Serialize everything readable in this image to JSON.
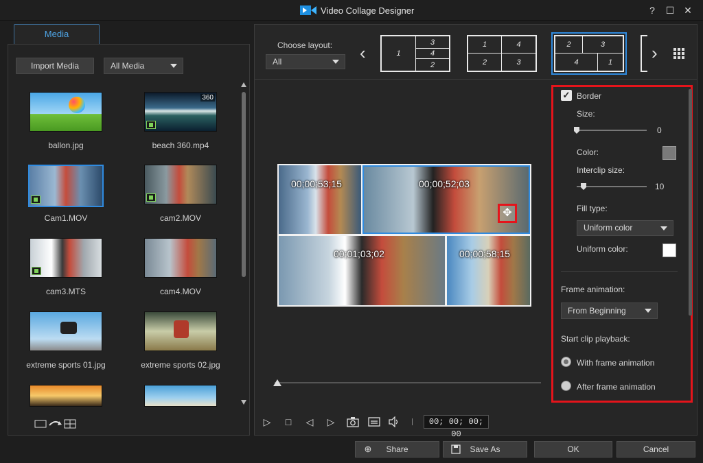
{
  "window": {
    "title": "Video Collage Designer",
    "help": "?",
    "maximize": "☐",
    "close": "✕"
  },
  "left": {
    "tab": "Media",
    "import_button": "Import Media",
    "filter": "All Media",
    "items": [
      {
        "label": "ballon.jpg"
      },
      {
        "label": "beach 360.mp4",
        "badge": "360"
      },
      {
        "label": "Cam1.MOV"
      },
      {
        "label": "cam2.MOV"
      },
      {
        "label": "cam3.MTS"
      },
      {
        "label": "cam4.MOV"
      },
      {
        "label": "extreme sports 01.jpg"
      },
      {
        "label": "extreme sports 02.jpg"
      }
    ]
  },
  "layout": {
    "choose_label": "Choose layout:",
    "filter": "All",
    "thumb1": [
      "1",
      "3",
      "4",
      "2"
    ],
    "thumb2": [
      "1",
      "4",
      "2",
      "3"
    ],
    "thumb3": [
      "2",
      "3",
      "4",
      "1"
    ]
  },
  "preview": {
    "timecodes": [
      "00;00;53;15",
      "00;00;52;03",
      "00;01;03;02",
      "00;00;58;15"
    ],
    "timecode_display": "00; 00; 00; 00"
  },
  "settings": {
    "border_label": "Border",
    "size_label": "Size:",
    "size_value": "0",
    "color_label": "Color:",
    "color": "#7a7a7a",
    "interclip_label": "Interclip size:",
    "interclip_value": "10",
    "fill_type_label": "Fill type:",
    "fill_type": "Uniform color",
    "uniform_color_label": "Uniform color:",
    "uniform_color": "#ffffff",
    "frame_anim_label": "Frame animation:",
    "frame_anim": "From Beginning",
    "start_playback_label": "Start clip playback:",
    "opt_with": "With frame animation",
    "opt_after": "After frame animation"
  },
  "footer": {
    "share": "Share",
    "save_as": "Save As",
    "ok": "OK",
    "cancel": "Cancel"
  },
  "colors": {
    "accent": "#2f8be0",
    "highlight": "#e5141b"
  }
}
